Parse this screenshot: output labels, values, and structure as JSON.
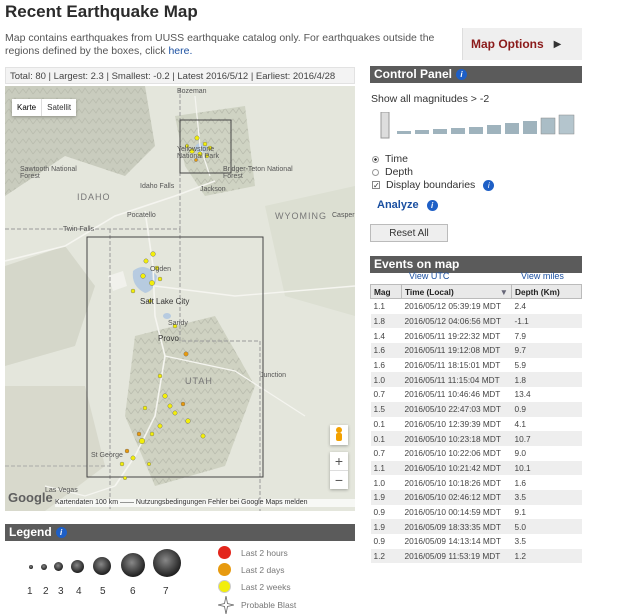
{
  "page": {
    "title": "Recent Earthquake Map",
    "intro_text": "Map contains earthquakes from UUSS earthquake catalog only. For earthquakes outside the regions defined by the boxes, click ",
    "intro_link": "here."
  },
  "map_options": {
    "label": "Map Options",
    "arrow": "▶"
  },
  "stats": {
    "text": "Total: 80 | Largest: 2.3 | Smallest: -0.2 | Latest 2016/5/12 | Earliest: 2016/4/28"
  },
  "map": {
    "type_buttons": [
      "Karte",
      "Satellit"
    ],
    "zoom_in": "+",
    "zoom_out": "−",
    "attribution": "Kartendaten   100 km ⎯⎯⎯⎯   Nutzungsbedingungen   Fehler bei Google Maps melden",
    "google_logo": "Google",
    "labels": {
      "las_vegas": "Las Vegas",
      "bozeman": "Bozeman",
      "yellowstone_np": "Yellowstone National Park",
      "jackson": "Jackson",
      "idaho_falls": "Idaho Falls",
      "pocatello": "Pocatello",
      "twin_falls": "Twin Falls",
      "idaho": "IDAHO",
      "wyoming": "WYOMING",
      "utah": "UTAH",
      "ogden": "Ogden",
      "salt_lake_city": "Salt Lake City",
      "provo": "Provo",
      "st_george": "St George",
      "sawtooth": "Sawtooth National Forest",
      "bridger": "Bridger-Teton National Forest",
      "casper": "Casper",
      "junction": "Junction",
      "sandy": "Sandy"
    },
    "colors": {
      "last_2_hours": "#e3261c",
      "last_2_days": "#e79a0f",
      "last_2_weeks": "#f2ee0b"
    }
  },
  "control_panel": {
    "title": "Control Panel",
    "magnitude_label": "Show all magnitudes > -2",
    "options": [
      {
        "label": "Time",
        "type": "radio",
        "checked": true
      },
      {
        "label": "Depth",
        "type": "radio",
        "checked": false
      },
      {
        "label": "Display boundaries",
        "type": "checkbox",
        "checked": true
      }
    ],
    "analyze_label": "Analyze",
    "reset_label": "Reset All"
  },
  "events": {
    "title": "Events on map",
    "view_utc": "View UTC",
    "view_miles": "View miles",
    "columns": [
      "Mag",
      "Time (Local)",
      "Depth (Km)"
    ],
    "sort_arrow": "▼",
    "rows": [
      [
        "1.1",
        "2016/05/12 05:39:19 MDT",
        "2.4"
      ],
      [
        "1.8",
        "2016/05/12 04:06:56 MDT",
        "-1.1"
      ],
      [
        "1.4",
        "2016/05/11 19:22:32 MDT",
        "7.9"
      ],
      [
        "1.6",
        "2016/05/11 19:12:08 MDT",
        "9.7"
      ],
      [
        "1.6",
        "2016/05/11 18:15:01 MDT",
        "5.9"
      ],
      [
        "1.0",
        "2016/05/11 11:15:04 MDT",
        "1.8"
      ],
      [
        "0.7",
        "2016/05/11 10:46:46 MDT",
        "13.4"
      ],
      [
        "1.5",
        "2016/05/10 22:47:03 MDT",
        "0.9"
      ],
      [
        "0.1",
        "2016/05/10 12:39:39 MDT",
        "4.1"
      ],
      [
        "0.1",
        "2016/05/10 10:23:18 MDT",
        "10.7"
      ],
      [
        "0.7",
        "2016/05/10 10:22:06 MDT",
        "9.0"
      ],
      [
        "1.1",
        "2016/05/10 10:21:42 MDT",
        "10.1"
      ],
      [
        "1.0",
        "2016/05/10 10:18:26 MDT",
        "1.6"
      ],
      [
        "1.9",
        "2016/05/10 02:46:12 MDT",
        "3.5"
      ],
      [
        "0.9",
        "2016/05/10 00:14:59 MDT",
        "9.1"
      ],
      [
        "1.9",
        "2016/05/09 18:33:35 MDT",
        "5.0"
      ],
      [
        "0.9",
        "2016/05/09 14:13:14 MDT",
        "3.5"
      ],
      [
        "1.2",
        "2016/05/09 11:53:19 MDT",
        "1.2"
      ]
    ]
  },
  "legend": {
    "title": "Legend",
    "sizes": [
      "1",
      "2",
      "3",
      "4",
      "5",
      "6",
      "7"
    ],
    "ages": [
      {
        "label": "Last 2 hours",
        "color": "#e3261c"
      },
      {
        "label": "Last 2 days",
        "color": "#e79a0f"
      },
      {
        "label": "Last 2 weeks",
        "color": "#f2ee0b"
      },
      {
        "label": "Probable Blast",
        "color": "none"
      }
    ]
  }
}
